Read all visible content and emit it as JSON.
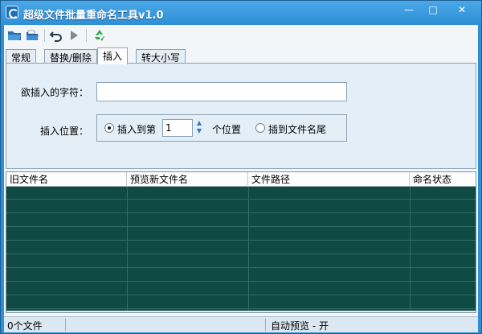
{
  "window": {
    "title": "超级文件批量重命名工具v1.0",
    "controls": {
      "minimize": "—",
      "maximize": "□",
      "close": "✕"
    }
  },
  "toolbar": {
    "buttons": [
      {
        "icon": "open-folder-icon"
      },
      {
        "icon": "open-files-icon"
      },
      {
        "icon": "undo-icon"
      },
      {
        "icon": "run-icon"
      },
      {
        "icon": "recycle-icon"
      }
    ]
  },
  "tabs": [
    {
      "label": "常规",
      "active": false
    },
    {
      "label": "替换/删除",
      "active": false
    },
    {
      "label": "插入",
      "active": true
    },
    {
      "label": "转大小写",
      "active": false
    }
  ],
  "insert_panel": {
    "char_label": "欲插入的字符：",
    "char_value": "",
    "position_label": "插入位置：",
    "radio_position_label": "插入到第",
    "position_value": "1",
    "position_suffix": "个位置",
    "radio_end_label": "插到文件名尾",
    "selected": "position"
  },
  "grid": {
    "columns": [
      "旧文件名",
      "预览新文件名",
      "文件路径",
      "命名状态"
    ],
    "row_count": 9
  },
  "statusbar": {
    "file_count": "0个文件",
    "preview_status": "自动预览 - 开"
  },
  "colors": {
    "title_bar": "#2f8fd6",
    "grid_background": "#0f4a43",
    "panel_background": "#e3eef6"
  }
}
